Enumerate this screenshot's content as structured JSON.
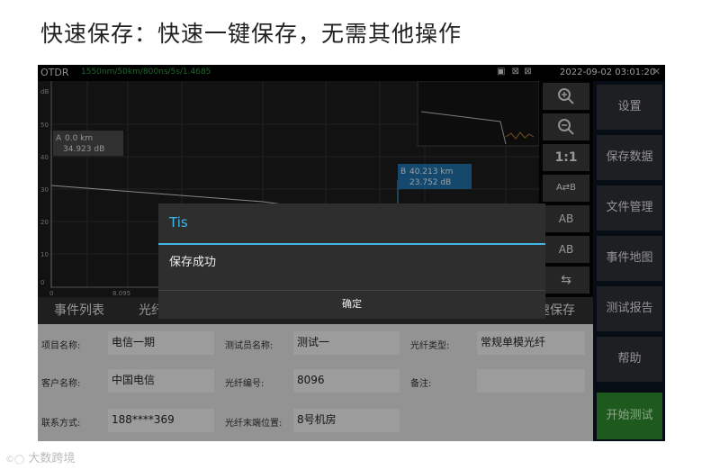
{
  "headline": "快速保存：快速一键保存，无需其他操作",
  "status": {
    "app_name": "OTDR",
    "params": "1550nm/50km/800ns/5s/1.4685",
    "datetime": "2022-09-02 03:01:20",
    "icons": [
      "image-icon",
      "no-wifi-icon",
      "no-signal-icon"
    ],
    "close_symbol": "✕"
  },
  "trace": {
    "y_unit": "dB",
    "y_ticks": [
      "50",
      "40",
      "30",
      "20",
      "10",
      "0"
    ],
    "x_ticks": [
      "0",
      "8.095"
    ],
    "cursor_a": {
      "name": "A",
      "distance": "0.0 km",
      "loss": "34.923 dB",
      "distance_km": 0.0,
      "loss_db": 34.923
    },
    "cursor_b": {
      "name": "B",
      "distance": "40.213 km",
      "loss": "23.752 dB",
      "distance_km": 40.213,
      "loss_db": 23.752
    }
  },
  "tools": {
    "zoom_in": "zoom-in-icon",
    "zoom_out": "zoom-out-icon",
    "ratio_label": "1:1",
    "ab_label": "AB"
  },
  "menu": {
    "settings": "设置",
    "save_data": "保存数据",
    "file_manager": "文件管理",
    "event_map": "事件地图",
    "test_report": "测试报告",
    "help": "帮助",
    "start_test": "开始测试"
  },
  "tabs": {
    "event_list": "事件列表",
    "fiber_partial": "光纤",
    "quick_save_partial": "速保存"
  },
  "form": {
    "project_name_label": "项目名称:",
    "project_name": "电信一期",
    "tester_label": "测试员名称:",
    "tester": "测试一",
    "fiber_type_label": "光纤类型:",
    "fiber_type": "常规单模光纤",
    "customer_label": "客户名称:",
    "customer": "中国电信",
    "fiber_no_label": "光纤编号:",
    "fiber_no": "8096",
    "note_label": "备注:",
    "note": "",
    "contact_label": "联系方式:",
    "contact": "188****369",
    "fiber_end_label": "光纤末端位置:",
    "fiber_end": "8号机房"
  },
  "dialog": {
    "title": "Tis",
    "message": "保存成功",
    "ok": "确定"
  },
  "watermark": "大数跨境",
  "colors": {
    "accent": "#3fb6e6",
    "start_button": "#2e8b2e",
    "params_text": "#2ea043"
  }
}
